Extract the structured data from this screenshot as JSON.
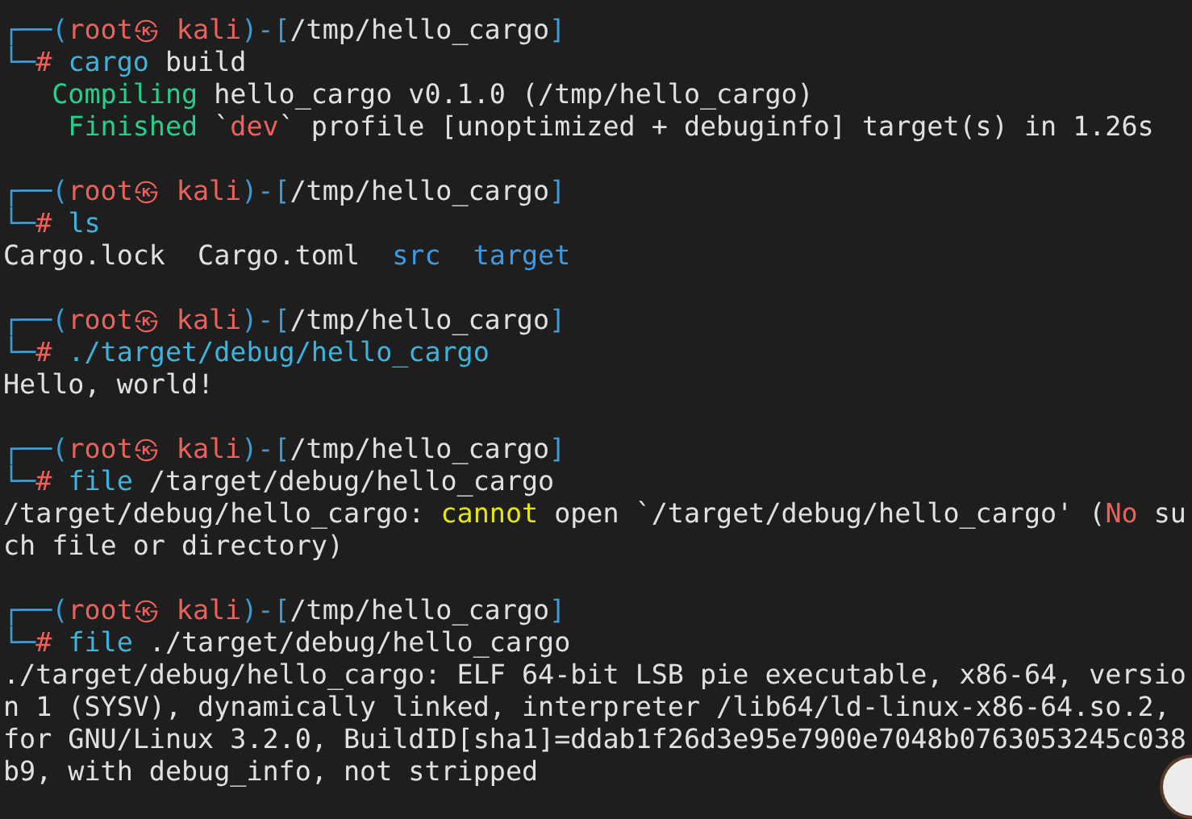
{
  "terminal": {
    "blocks": [
      {
        "lines": [
          {
            "segments": [
              {
                "kind": "box",
                "text": "┌──("
              },
              {
                "kind": "user",
                "text": "root㉿ kali"
              },
              {
                "kind": "box",
                "text": ")-["
              },
              {
                "kind": "text",
                "text": "/tmp/hello_cargo"
              },
              {
                "kind": "box",
                "text": "]"
              }
            ]
          },
          {
            "segments": [
              {
                "kind": "box",
                "text": "└─"
              },
              {
                "kind": "hash",
                "text": "# "
              },
              {
                "kind": "cmd",
                "text": "cargo"
              },
              {
                "kind": "text",
                "text": " build"
              }
            ]
          },
          {
            "segments": [
              {
                "kind": "ok",
                "text": "   Compiling"
              },
              {
                "kind": "text",
                "text": " hello_cargo v0.1.0 (/tmp/hello_cargo)"
              }
            ]
          },
          {
            "segments": [
              {
                "kind": "ok",
                "text": "    Finished"
              },
              {
                "kind": "text",
                "text": " `"
              },
              {
                "kind": "err",
                "text": "dev"
              },
              {
                "kind": "text",
                "text": "` profile [unoptimized + debuginfo] target(s) in 1.26s"
              }
            ]
          }
        ]
      },
      {
        "lines": [
          {
            "segments": [
              {
                "kind": "box",
                "text": "┌──("
              },
              {
                "kind": "user",
                "text": "root㉿ kali"
              },
              {
                "kind": "box",
                "text": ")-["
              },
              {
                "kind": "text",
                "text": "/tmp/hello_cargo"
              },
              {
                "kind": "box",
                "text": "]"
              }
            ]
          },
          {
            "segments": [
              {
                "kind": "box",
                "text": "└─"
              },
              {
                "kind": "hash",
                "text": "# "
              },
              {
                "kind": "cmd",
                "text": "ls"
              }
            ]
          },
          {
            "segments": [
              {
                "kind": "text",
                "text": "Cargo.lock  Cargo.toml  "
              },
              {
                "kind": "dir",
                "text": "src"
              },
              {
                "kind": "dir",
                "text": "  target"
              }
            ]
          }
        ]
      },
      {
        "lines": [
          {
            "segments": [
              {
                "kind": "box",
                "text": "┌──("
              },
              {
                "kind": "user",
                "text": "root㉿ kali"
              },
              {
                "kind": "box",
                "text": ")-["
              },
              {
                "kind": "text",
                "text": "/tmp/hello_cargo"
              },
              {
                "kind": "box",
                "text": "]"
              }
            ]
          },
          {
            "segments": [
              {
                "kind": "box",
                "text": "└─"
              },
              {
                "kind": "hash",
                "text": "# "
              },
              {
                "kind": "cmd",
                "text": "./target/debug/hello_cargo"
              }
            ]
          },
          {
            "segments": [
              {
                "kind": "text",
                "text": "Hello, world!"
              }
            ]
          }
        ]
      },
      {
        "lines": [
          {
            "segments": [
              {
                "kind": "box",
                "text": "┌──("
              },
              {
                "kind": "user",
                "text": "root㉿ kali"
              },
              {
                "kind": "box",
                "text": ")-["
              },
              {
                "kind": "text",
                "text": "/tmp/hello_cargo"
              },
              {
                "kind": "box",
                "text": "]"
              }
            ]
          },
          {
            "segments": [
              {
                "kind": "box",
                "text": "└─"
              },
              {
                "kind": "hash",
                "text": "# "
              },
              {
                "kind": "cmd",
                "text": "file"
              },
              {
                "kind": "text",
                "text": " /target/debug/hello_cargo"
              }
            ]
          },
          {
            "segments": [
              {
                "kind": "text",
                "text": "/target/debug/hello_cargo: "
              },
              {
                "kind": "warn",
                "text": "cannot"
              },
              {
                "kind": "text",
                "text": " open `/target/debug/hello_cargo' ("
              },
              {
                "kind": "err",
                "text": "No"
              },
              {
                "kind": "text",
                "text": " su"
              }
            ]
          },
          {
            "segments": [
              {
                "kind": "text",
                "text": "ch file or directory)"
              }
            ]
          }
        ]
      },
      {
        "lines": [
          {
            "segments": [
              {
                "kind": "box",
                "text": "┌──("
              },
              {
                "kind": "user",
                "text": "root㉿ kali"
              },
              {
                "kind": "box",
                "text": ")-["
              },
              {
                "kind": "text",
                "text": "/tmp/hello_cargo"
              },
              {
                "kind": "box",
                "text": "]"
              }
            ]
          },
          {
            "segments": [
              {
                "kind": "box",
                "text": "└─"
              },
              {
                "kind": "hash",
                "text": "# "
              },
              {
                "kind": "cmd",
                "text": "file"
              },
              {
                "kind": "text",
                "text": " ./target/debug/hello_cargo"
              }
            ]
          },
          {
            "segments": [
              {
                "kind": "text",
                "text": "./target/debug/hello_cargo: ELF 64-bit LSB pie executable, x86-64, versio"
              }
            ]
          },
          {
            "segments": [
              {
                "kind": "text",
                "text": "n 1 (SYSV), dynamically linked, interpreter /lib64/ld-linux-x86-64.so.2,"
              }
            ]
          },
          {
            "segments": [
              {
                "kind": "text",
                "text": "for GNU/Linux 3.2.0, BuildID[sha1]=ddab1f26d3e95e7900e7048b0763053245c038"
              }
            ]
          },
          {
            "segments": [
              {
                "kind": "text",
                "text": "b9, with debug_info, not stripped"
              }
            ]
          }
        ]
      }
    ]
  }
}
